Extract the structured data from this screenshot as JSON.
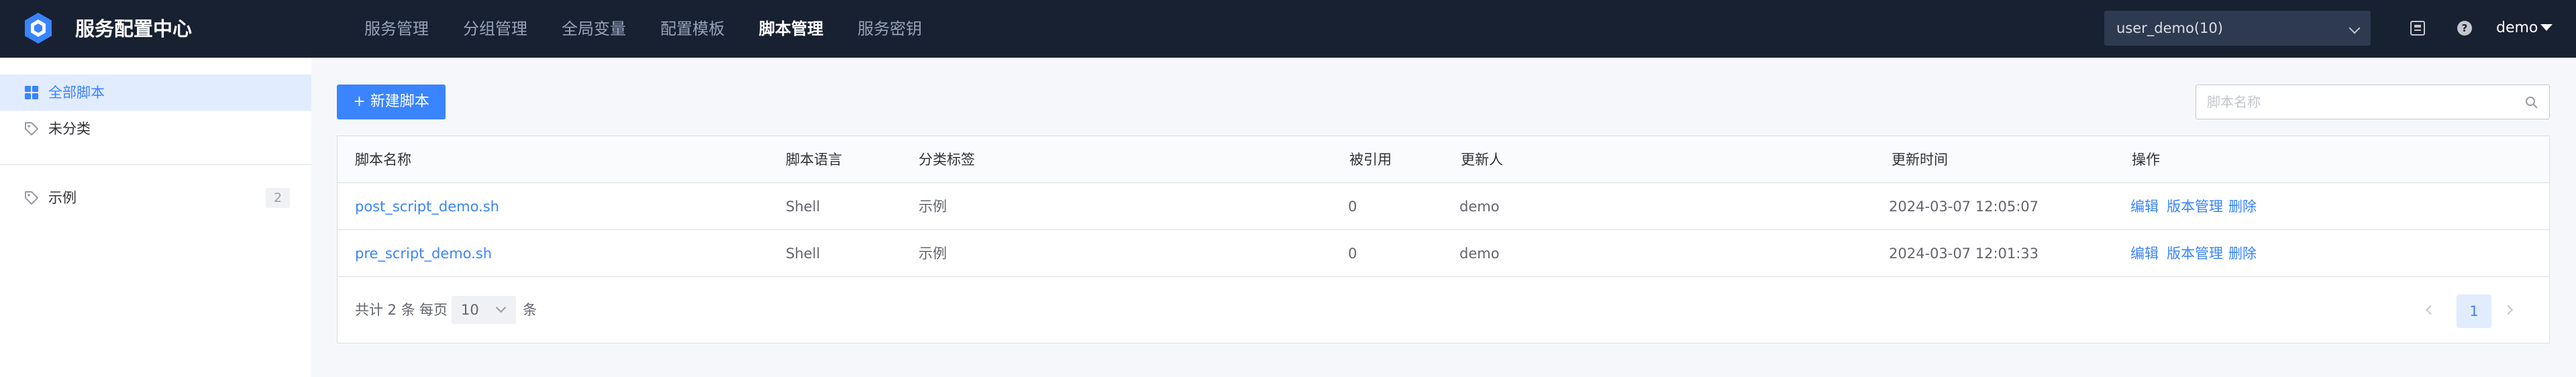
{
  "app": {
    "title": "服务配置中心",
    "logo_icon": "hexagon-logo-icon",
    "accent_color": "#3a84ff",
    "header_bg": "#182132"
  },
  "nav": {
    "items": [
      {
        "label": "服务管理",
        "active": false
      },
      {
        "label": "分组管理",
        "active": false
      },
      {
        "label": "全局变量",
        "active": false
      },
      {
        "label": "配置模板",
        "active": false
      },
      {
        "label": "脚本管理",
        "active": true
      },
      {
        "label": "服务密钥",
        "active": false
      }
    ]
  },
  "header": {
    "business_select": "user_demo(10)",
    "icons": [
      "release-notes-icon",
      "help-icon"
    ],
    "user": "demo"
  },
  "sidebar": {
    "items": [
      {
        "label": "全部脚本",
        "icon": "grid-icon",
        "active": true
      },
      {
        "label": "未分类",
        "icon": "tag-icon",
        "active": false
      }
    ],
    "tags": [
      {
        "label": "示例",
        "icon": "tag-icon",
        "count": "2"
      }
    ]
  },
  "toolbar": {
    "new_button": "+ 新建脚本",
    "search_placeholder": "脚本名称",
    "search_icon": "search-icon"
  },
  "table": {
    "columns": [
      "脚本名称",
      "脚本语言",
      "分类标签",
      "被引用",
      "更新人",
      "更新时间",
      "操作"
    ],
    "rows": [
      {
        "name": "post_script_demo.sh",
        "language": "Shell",
        "tag": "示例",
        "references": "0",
        "updater": "demo",
        "updated_at": "2024-03-07 12:05:07"
      },
      {
        "name": "pre_script_demo.sh",
        "language": "Shell",
        "tag": "示例",
        "references": "0",
        "updater": "demo",
        "updated_at": "2024-03-07 12:01:33"
      }
    ],
    "actions": [
      "编辑",
      "版本管理",
      "删除"
    ]
  },
  "pagination": {
    "total": "共计 2 条",
    "per_page_label": "每页",
    "page_size": "10",
    "unit": "条",
    "current_page": "1"
  }
}
